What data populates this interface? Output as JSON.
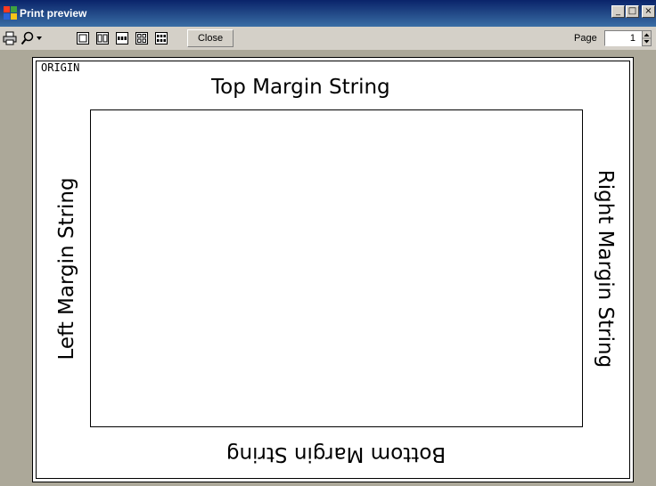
{
  "window": {
    "title": "Print preview",
    "minimize_glyph": "_",
    "maximize_glyph": "□",
    "close_glyph": "×"
  },
  "toolbar": {
    "close_label": "Close",
    "page_label": "Page",
    "page_value": "1",
    "icons": [
      "printer-icon",
      "zoom-icon",
      "zoom-dropdown-icon",
      "one-page-icon",
      "two-pages-icon",
      "three-pages-icon",
      "four-pages-icon",
      "six-pages-icon"
    ]
  },
  "preview": {
    "origin_label": "ORIGIN",
    "top_margin": "Top Margin String",
    "left_margin": "Left Margin String",
    "right_margin": "Right Margin String",
    "bottom_margin": "Bottom Margin String"
  },
  "colors": {
    "titlebar": "#0a246a",
    "chrome": "#d4d0c8",
    "preview_bg": "#aca899",
    "page": "#ffffff"
  }
}
